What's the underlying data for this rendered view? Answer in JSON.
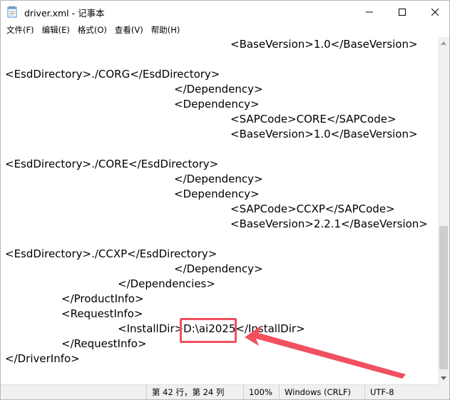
{
  "window": {
    "title": "driver.xml - 记事本",
    "controls": {
      "minimize": "minimize-icon",
      "maximize": "maximize-icon",
      "close": "close-icon"
    }
  },
  "menu": {
    "items": [
      "文件(F)",
      "编辑(E)",
      "格式(O)",
      "查看(V)",
      "帮助(H)"
    ]
  },
  "editor": {
    "lines": [
      "\t\t\t\t<BaseVersion>1.0</BaseVersion>",
      "",
      "<EsdDirectory>./CORG</EsdDirectory>",
      "\t\t\t</Dependency>",
      "\t\t\t<Dependency>",
      "\t\t\t\t<SAPCode>CORE</SAPCode>",
      "\t\t\t\t<BaseVersion>1.0</BaseVersion>",
      "",
      "<EsdDirectory>./CORE</EsdDirectory>",
      "\t\t\t</Dependency>",
      "\t\t\t<Dependency>",
      "\t\t\t\t<SAPCode>CCXP</SAPCode>",
      "\t\t\t\t<BaseVersion>2.2.1</BaseVersion>",
      "",
      "<EsdDirectory>./CCXP</EsdDirectory>",
      "\t\t\t</Dependency>",
      "\t\t</Dependencies>",
      "\t</ProductInfo>",
      "\t<RequestInfo>",
      "\t\t<InstallDir>D:\\ai2025</InstallDir>",
      "\t</RequestInfo>",
      "</DriverInfo>"
    ],
    "highlighted_value": "D:\\ai2025"
  },
  "statusbar": {
    "position": "第 42 行，第 24 列",
    "zoom": "100%",
    "line_ending": "Windows (CRLF)",
    "encoding": "UTF-8"
  },
  "annotation": {
    "color": "#f0505f"
  }
}
